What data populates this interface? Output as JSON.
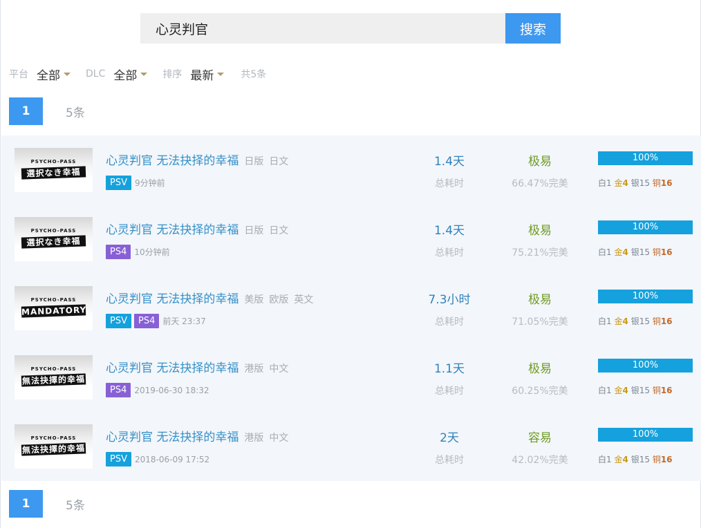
{
  "search": {
    "value": "心灵判官",
    "button_label": "搜索"
  },
  "filters": {
    "platform_label": "平台",
    "platform_value": "全部",
    "dlc_label": "DLC",
    "dlc_value": "全部",
    "sort_label": "排序",
    "sort_value": "最新",
    "total": "共5条"
  },
  "pager_top": {
    "page": "1",
    "count": "5条"
  },
  "pager_bottom": {
    "page": "1",
    "count": "5条"
  },
  "games": [
    {
      "cover_top": "PSYCHO-PASS",
      "cover_title": "選択なき幸福",
      "title": "心灵判官 无法抉择的幸福",
      "tags": [
        "日版",
        "日文"
      ],
      "platforms": [
        "PSV"
      ],
      "time": "9分钟前",
      "duration": "1.4天",
      "duration_label": "总耗时",
      "difficulty": "极易",
      "perfect": "66.47%完美",
      "progress": "100%",
      "trophies": {
        "plat_label": "白",
        "plat": "1",
        "gold_label": "金",
        "gold": "4",
        "silver_label": "银",
        "silver": "15",
        "bronze_label": "铜",
        "bronze": "16"
      }
    },
    {
      "cover_top": "PSYCHO-PASS",
      "cover_title": "選択なき幸福",
      "title": "心灵判官 无法抉择的幸福",
      "tags": [
        "日版",
        "日文"
      ],
      "platforms": [
        "PS4"
      ],
      "time": "10分钟前",
      "duration": "1.4天",
      "duration_label": "总耗时",
      "difficulty": "极易",
      "perfect": "75.21%完美",
      "progress": "100%",
      "trophies": {
        "plat_label": "白",
        "plat": "1",
        "gold_label": "金",
        "gold": "4",
        "silver_label": "银",
        "silver": "15",
        "bronze_label": "铜",
        "bronze": "16"
      }
    },
    {
      "cover_top": "PSYCHO-PASS",
      "cover_title": "MANDATORY",
      "title": "心灵判官 无法抉择的幸福",
      "tags": [
        "美版",
        "欧版",
        "英文"
      ],
      "platforms": [
        "PSV",
        "PS4"
      ],
      "time": "前天 23:37",
      "duration": "7.3小时",
      "duration_label": "总耗时",
      "difficulty": "极易",
      "perfect": "71.05%完美",
      "progress": "100%",
      "trophies": {
        "plat_label": "白",
        "plat": "1",
        "gold_label": "金",
        "gold": "4",
        "silver_label": "银",
        "silver": "15",
        "bronze_label": "铜",
        "bronze": "16"
      }
    },
    {
      "cover_top": "PSYCHO-PASS",
      "cover_title": "無法抉擇的幸福",
      "title": "心灵判官 无法抉择的幸福",
      "tags": [
        "港版",
        "中文"
      ],
      "platforms": [
        "PS4"
      ],
      "time": "2019-06-30 18:32",
      "duration": "1.1天",
      "duration_label": "总耗时",
      "difficulty": "极易",
      "perfect": "60.25%完美",
      "progress": "100%",
      "trophies": {
        "plat_label": "白",
        "plat": "1",
        "gold_label": "金",
        "gold": "4",
        "silver_label": "银",
        "silver": "15",
        "bronze_label": "铜",
        "bronze": "16"
      }
    },
    {
      "cover_top": "PSYCHO-PASS",
      "cover_title": "無法抉擇的幸福",
      "title": "心灵判官 无法抉择的幸福",
      "tags": [
        "港版",
        "中文"
      ],
      "platforms": [
        "PSV"
      ],
      "time": "2018-06-09 17:52",
      "duration": "2天",
      "duration_label": "总耗时",
      "difficulty": "容易",
      "perfect": "42.02%完美",
      "progress": "100%",
      "trophies": {
        "plat_label": "白",
        "plat": "1",
        "gold_label": "金",
        "gold": "4",
        "silver_label": "银",
        "silver": "15",
        "bronze_label": "铜",
        "bronze": "16"
      }
    }
  ]
}
